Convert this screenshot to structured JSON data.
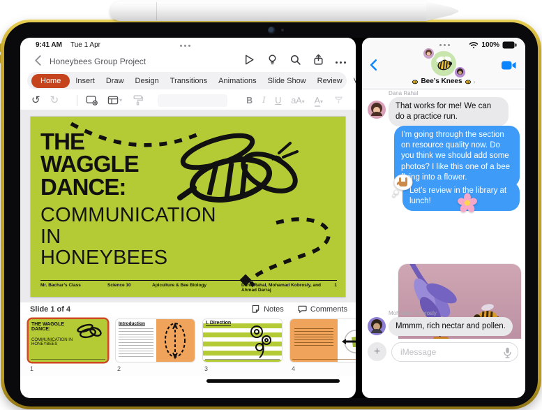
{
  "device": {
    "status_left": {
      "time": "9:41 AM",
      "date": "Tue 1 Apr"
    },
    "status_right": {
      "battery": "100%"
    }
  },
  "powerpoint": {
    "doc_title": "Honeybees Group Project",
    "tabs": [
      "Home",
      "Insert",
      "Draw",
      "Design",
      "Transitions",
      "Animations",
      "Slide Show",
      "Review",
      "View"
    ],
    "toolbar": {
      "bold": "B",
      "italic": "I",
      "underline": "U",
      "text_size": "aA",
      "font_color": "A"
    },
    "slide": {
      "title_lines": [
        "THE",
        "WAGGLE",
        "DANCE:"
      ],
      "subtitle_lines": [
        "COMMUNICATION",
        "IN",
        "HONEYBEES"
      ],
      "footer": {
        "class_name": "Mr. Bachar’s Class",
        "course": "Science 10",
        "topic": "Apiculture & Bee Biology",
        "authors": "Dana Rahal, Mohamad Kobrosly, and Ahmad Darraj",
        "slide_number": "1"
      }
    },
    "statusbar": {
      "slide_label": "Slide 1 of 4",
      "notes": "Notes",
      "comments": "Comments"
    },
    "thumbnails": [
      {
        "number": "1",
        "title": "THE WAGGLE DANCE:",
        "subtitle": "COMMUNICATION IN HONEYBEES"
      },
      {
        "number": "2",
        "heading": "Introduction"
      },
      {
        "number": "3",
        "heading": "I. Direction"
      },
      {
        "number": "4"
      }
    ],
    "colors": {
      "accent": "#C5431D",
      "slide_green": "#B5CB35",
      "thumb_orange": "#F0A35B"
    }
  },
  "messages": {
    "conversation_name": "Bee’s Knees",
    "sender_labels": {
      "first": "Dana Rahal",
      "second": "Mohamad Kobrosly"
    },
    "bubbles": {
      "received1": "That works for me! We can do a practice run.",
      "sent1": "I’m going through the section on resource quality now. Do you think we should add some photos? I like this one of a bee flying into a flower.",
      "sent2": "Let’s review in the library at lunch!",
      "received2": "Mmmm, rich nectar and pollen."
    },
    "composer": {
      "placeholder": "iMessage"
    },
    "colors": {
      "sent_blue": "#3E9BF7",
      "received_gray": "#E9E9EB"
    }
  }
}
